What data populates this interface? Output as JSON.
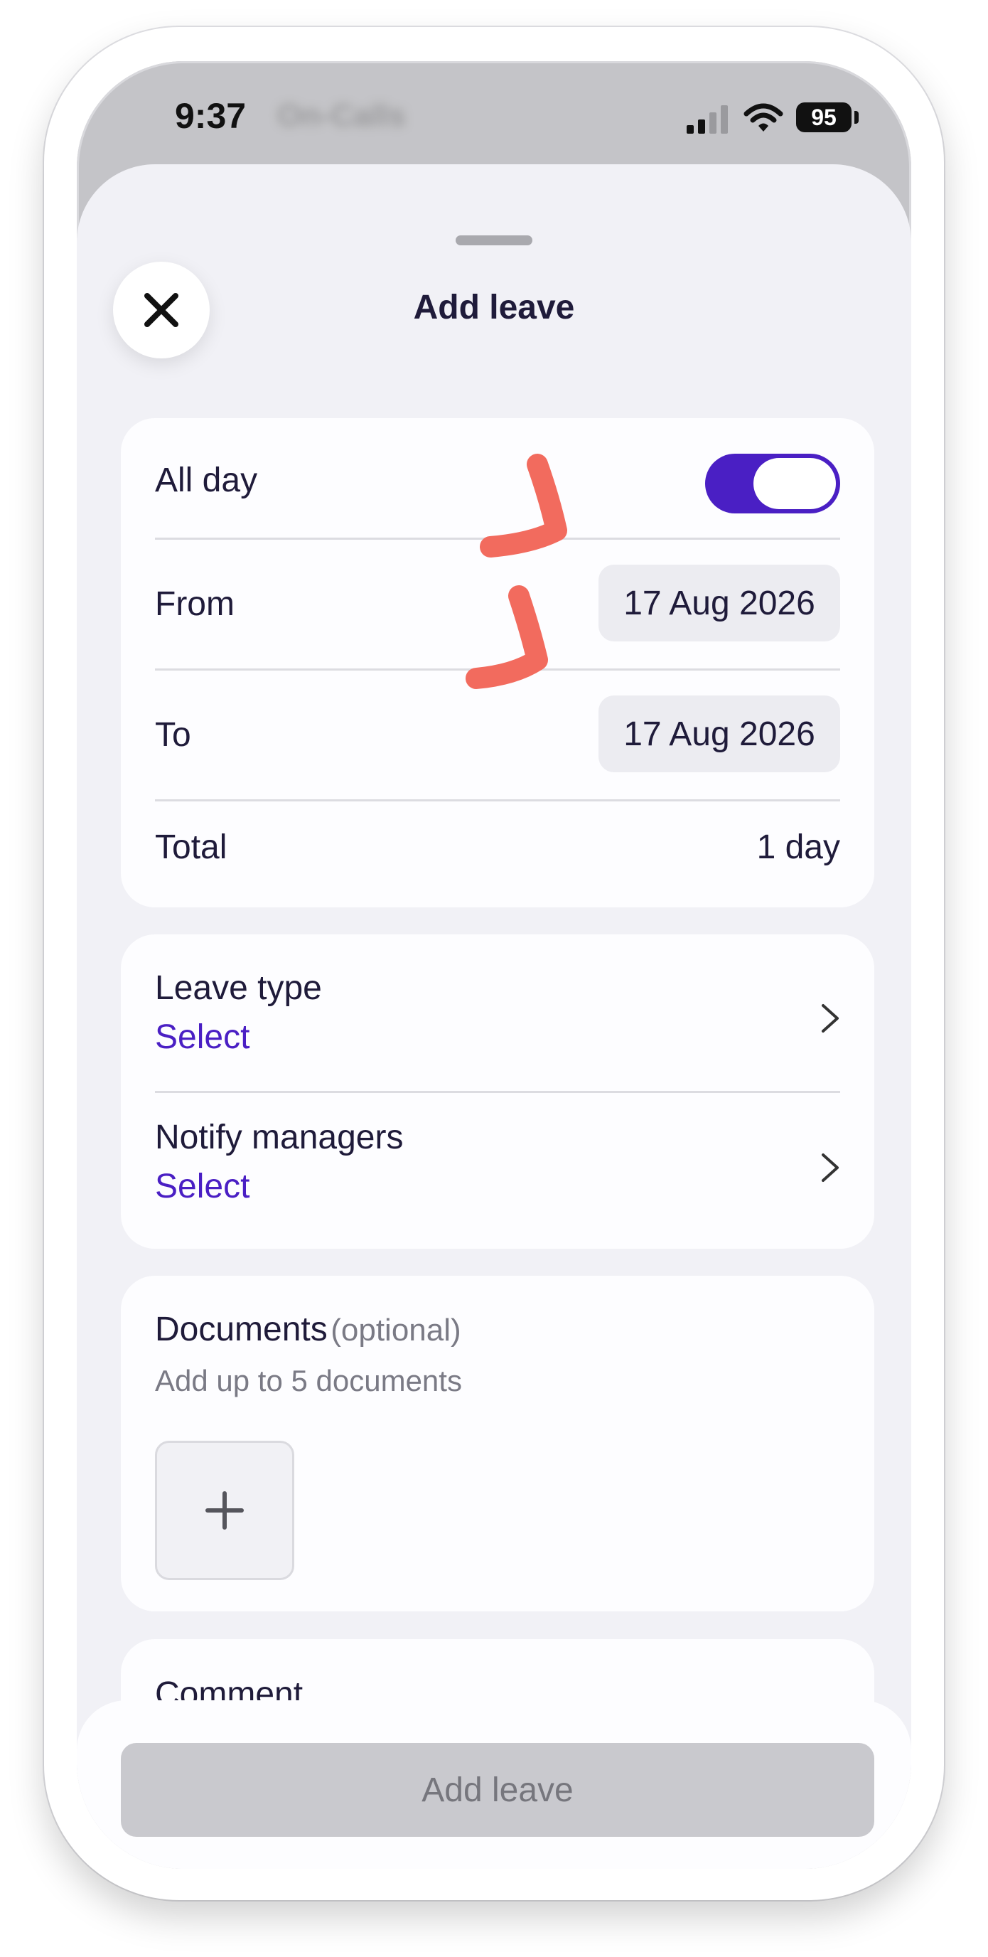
{
  "status_bar": {
    "time": "9:37",
    "app_label": "On-Calls",
    "battery": "95"
  },
  "header": {
    "title": "Add leave",
    "close_icon": "close-icon"
  },
  "dates_card": {
    "all_day_label": "All day",
    "all_day_on": true,
    "from_label": "From",
    "from_value": "17 Aug 2026",
    "to_label": "To",
    "to_value": "17 Aug 2026",
    "total_label": "Total",
    "total_value": "1 day"
  },
  "selection_card": {
    "leave_type_label": "Leave type",
    "leave_type_value": "Select",
    "notify_label": "Notify managers",
    "notify_value": "Select"
  },
  "documents_card": {
    "title": "Documents",
    "optional": "(optional)",
    "hint": "Add up to 5 documents"
  },
  "comment_card": {
    "title": "Comment"
  },
  "footer": {
    "button_label": "Add leave"
  },
  "colors": {
    "accent": "#4a1fc4",
    "annotation": "#f26b5e",
    "sheet_bg": "#f1f1f6",
    "disabled_button": "#c9c9ce"
  }
}
